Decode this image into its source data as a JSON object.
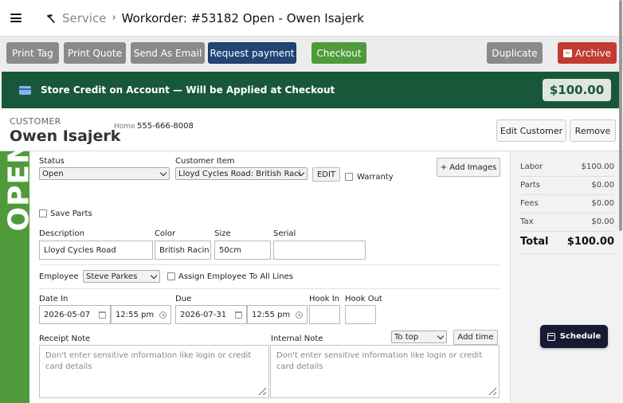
{
  "header": {
    "breadcrumb_section": "Service",
    "title": "Workorder: #53182 Open - Owen Isajerk"
  },
  "toolbar": {
    "print_tag": "Print Tag",
    "print_quote": "Print Quote",
    "send_email": "Send As Email",
    "request_payment": "Request payment",
    "checkout": "Checkout",
    "duplicate": "Duplicate",
    "archive": "Archive"
  },
  "credit": {
    "message": "Store Credit on Account — Will be Applied at Checkout",
    "amount": "$100.00"
  },
  "customer": {
    "label": "CUSTOMER",
    "name": "Owen Isajerk",
    "phone_type": "Home",
    "phone": "555-666-8008",
    "edit_label": "Edit Customer",
    "remove_label": "Remove"
  },
  "status_banner": "OPEN",
  "form": {
    "status_label": "Status",
    "status_value": "Open",
    "item_label": "Customer Item",
    "item_value": "Lloyd Cycles Road: British Raci",
    "edit_label": "EDIT",
    "warranty_label": "Warranty",
    "add_images": "+ Add Images",
    "save_parts": "Save Parts",
    "description_label": "Description",
    "description_value": "Lloyd Cycles Road",
    "color_label": "Color",
    "color_value": "British Racin",
    "size_label": "Size",
    "size_value": "50cm",
    "serial_label": "Serial",
    "serial_value": "",
    "employee_label": "Employee",
    "employee_value": "Steve Parkes",
    "assign_label": "Assign Employee To All Lines",
    "date_in_label": "Date In",
    "date_in_value": "2026-05-07",
    "date_in_time": "12:55 pm",
    "due_label": "Due",
    "due_value": "2026-07-31",
    "due_time": "12:55 pm",
    "hook_in_label": "Hook In",
    "hook_out_label": "Hook Out",
    "receipt_note_label": "Receipt Note",
    "internal_note_label": "Internal Note",
    "to_top_value": "To top",
    "add_time": "Add time",
    "receipt_placeholder": "Don't enter sensitive information like login or credit card details",
    "internal_placeholder": "Don't enter sensitive information like login or credit card details"
  },
  "totals": {
    "labor_label": "Labor",
    "labor": "$100.00",
    "parts_label": "Parts",
    "parts": "$0.00",
    "fees_label": "Fees",
    "fees": "$0.00",
    "tax_label": "Tax",
    "tax": "$0.00",
    "total_label": "Total",
    "total": "$100.00"
  },
  "schedule_label": "Schedule",
  "colors": {
    "status_green": "#4f9a3a",
    "credit_banner": "#19573a",
    "primary_navy": "#1f4476",
    "archive_red": "#c23b32",
    "schedule_dark": "#161a33"
  }
}
